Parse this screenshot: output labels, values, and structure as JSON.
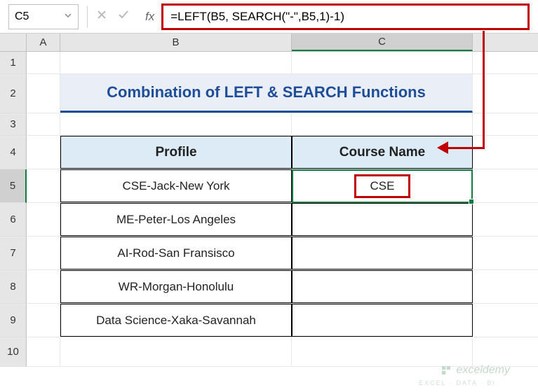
{
  "nameBox": {
    "value": "C5"
  },
  "formulaBar": {
    "formula": "=LEFT(B5, SEARCH(\"-\",B5,1)-1)"
  },
  "columns": {
    "A": "A",
    "B": "B",
    "C": "C"
  },
  "rows": {
    "r1": "1",
    "r2": "2",
    "r3": "3",
    "r4": "4",
    "r5": "5",
    "r6": "6",
    "r7": "7",
    "r8": "8",
    "r9": "9",
    "r10": "10"
  },
  "title": "Combination of LEFT & SEARCH Functions",
  "headers": {
    "profile": "Profile",
    "course": "Course Name"
  },
  "data": {
    "r5": {
      "profile": "CSE-Jack-New York",
      "course": "CSE"
    },
    "r6": {
      "profile": "ME-Peter-Los Angeles",
      "course": ""
    },
    "r7": {
      "profile": "AI-Rod-San Fransisco",
      "course": ""
    },
    "r8": {
      "profile": "WR-Morgan-Honolulu",
      "course": ""
    },
    "r9": {
      "profile": "Data Science-Xaka-Savannah",
      "course": ""
    }
  },
  "watermark": {
    "brand": "exceldemy",
    "sub": "EXCEL · DATA · BI"
  }
}
